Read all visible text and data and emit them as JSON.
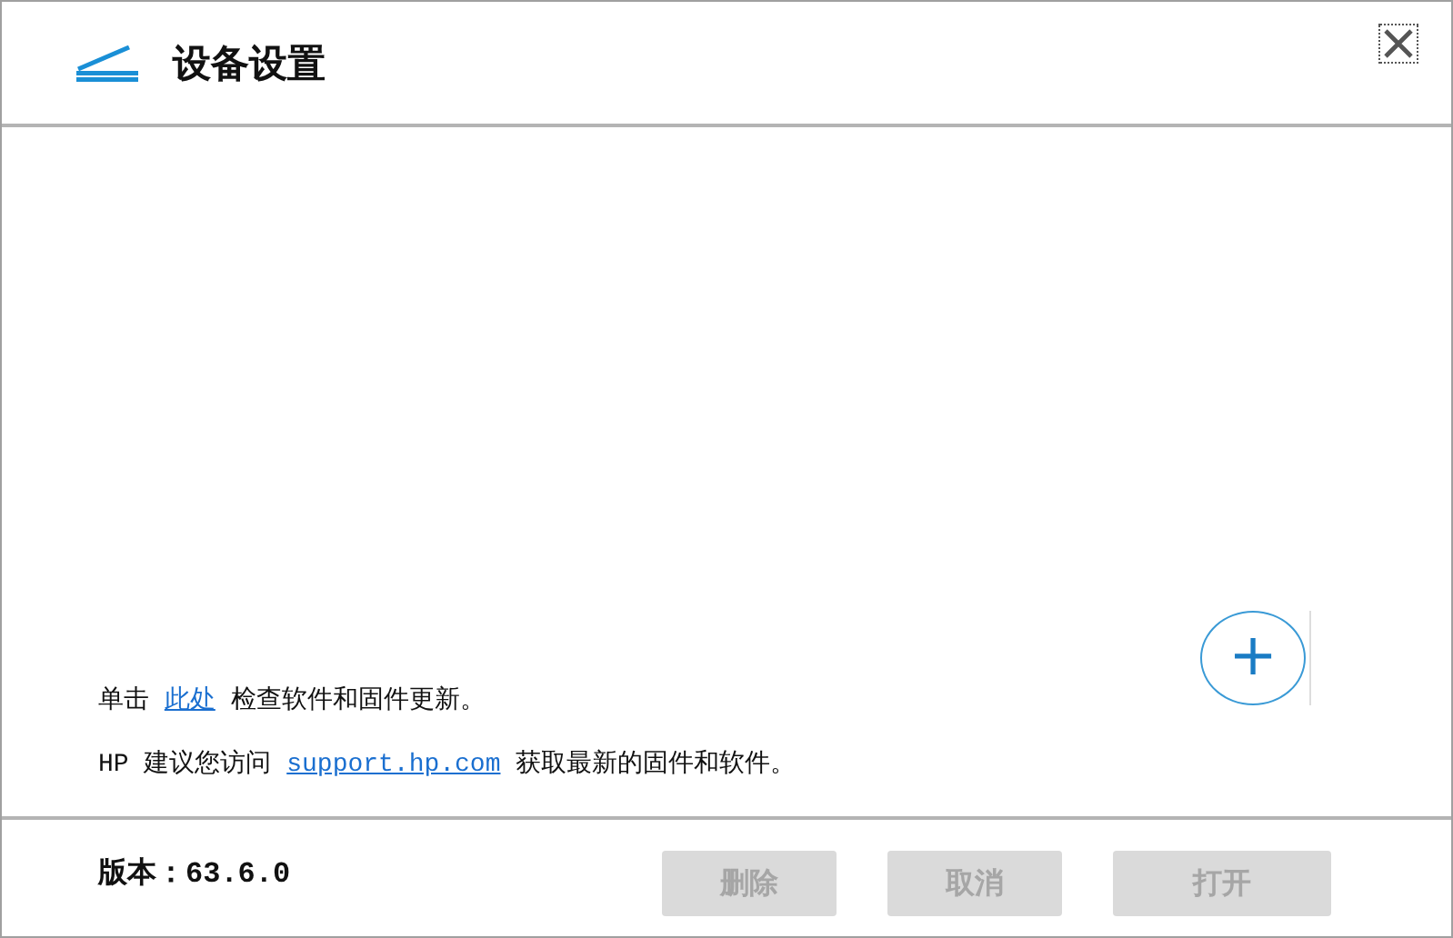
{
  "window": {
    "title": "设备设置"
  },
  "messages": [
    {
      "before": "单击 ",
      "link": "此处",
      "after": " 检查软件和固件更新。"
    },
    {
      "before": "HP 建议您访问 ",
      "link": "support.hp.com",
      "after": " 获取最新的固件和软件。"
    }
  ],
  "add_button": {
    "label": "+"
  },
  "footer": {
    "version": "版本：63.6.0"
  },
  "buttons": [
    {
      "label": "删除",
      "disabled": true
    },
    {
      "label": "取消",
      "disabled": true
    },
    {
      "label": "打开",
      "disabled": true
    }
  ]
}
